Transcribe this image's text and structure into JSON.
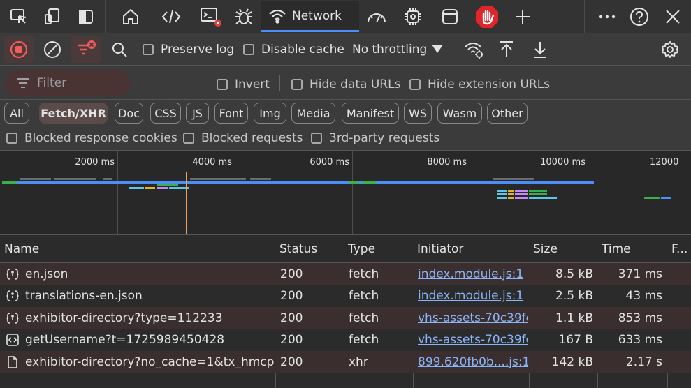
{
  "tabs": {
    "network_label": "Network"
  },
  "toolbar": {
    "preserve_log": "Preserve log",
    "disable_cache": "Disable cache",
    "throttling": "No throttling"
  },
  "filter": {
    "placeholder": "Filter",
    "invert": "Invert",
    "hide_data_urls": "Hide data URLs",
    "hide_extension_urls": "Hide extension URLs"
  },
  "types": [
    "All",
    "Fetch/XHR",
    "Doc",
    "CSS",
    "JS",
    "Font",
    "Img",
    "Media",
    "Manifest",
    "WS",
    "Wasm",
    "Other"
  ],
  "active_type": "Fetch/XHR",
  "blocked": {
    "cookies": "Blocked response cookies",
    "requests": "Blocked requests",
    "third_party": "3rd-party requests"
  },
  "overview": {
    "ticks": [
      "2000 ms",
      "4000 ms",
      "6000 ms",
      "8000 ms",
      "10000 ms",
      "12000"
    ]
  },
  "table": {
    "headers": {
      "name": "Name",
      "status": "Status",
      "type": "Type",
      "initiator": "Initiator",
      "size": "Size",
      "time": "Time",
      "more": "F..."
    },
    "rows": [
      {
        "name": "en.json",
        "icon": "json-icon",
        "status": "200",
        "type": "fetch",
        "initiator": "index.module.js:1",
        "size": "8.5 kB",
        "time": "371 ms"
      },
      {
        "name": "translations-en.json",
        "icon": "json-icon",
        "status": "200",
        "type": "fetch",
        "initiator": "index.module.js:1",
        "size": "2.5 kB",
        "time": "43 ms"
      },
      {
        "name": "exhibitor-directory?type=112233",
        "icon": "json-icon",
        "status": "200",
        "type": "fetch",
        "initiator": "vhs-assets-70c39fc...",
        "size": "1.1 kB",
        "time": "853 ms"
      },
      {
        "name": "getUsername?t=1725989450428",
        "icon": "code-icon",
        "status": "200",
        "type": "fetch",
        "initiator": "vhs-assets-70c39fc...",
        "size": "167 B",
        "time": "633 ms"
      },
      {
        "name": "exhibitor-directory?no_cache=1&tx_hmcpl...",
        "icon": "document-icon",
        "status": "200",
        "type": "xhr",
        "initiator": "899.620fb0b....js:1",
        "size": "142 kB",
        "time": "2.17 s"
      }
    ]
  },
  "colors": {
    "accent": "#4c8ef7",
    "record": "#f25b5b",
    "link": "#8ab4f8",
    "row_alt": "#3a2f2e"
  }
}
